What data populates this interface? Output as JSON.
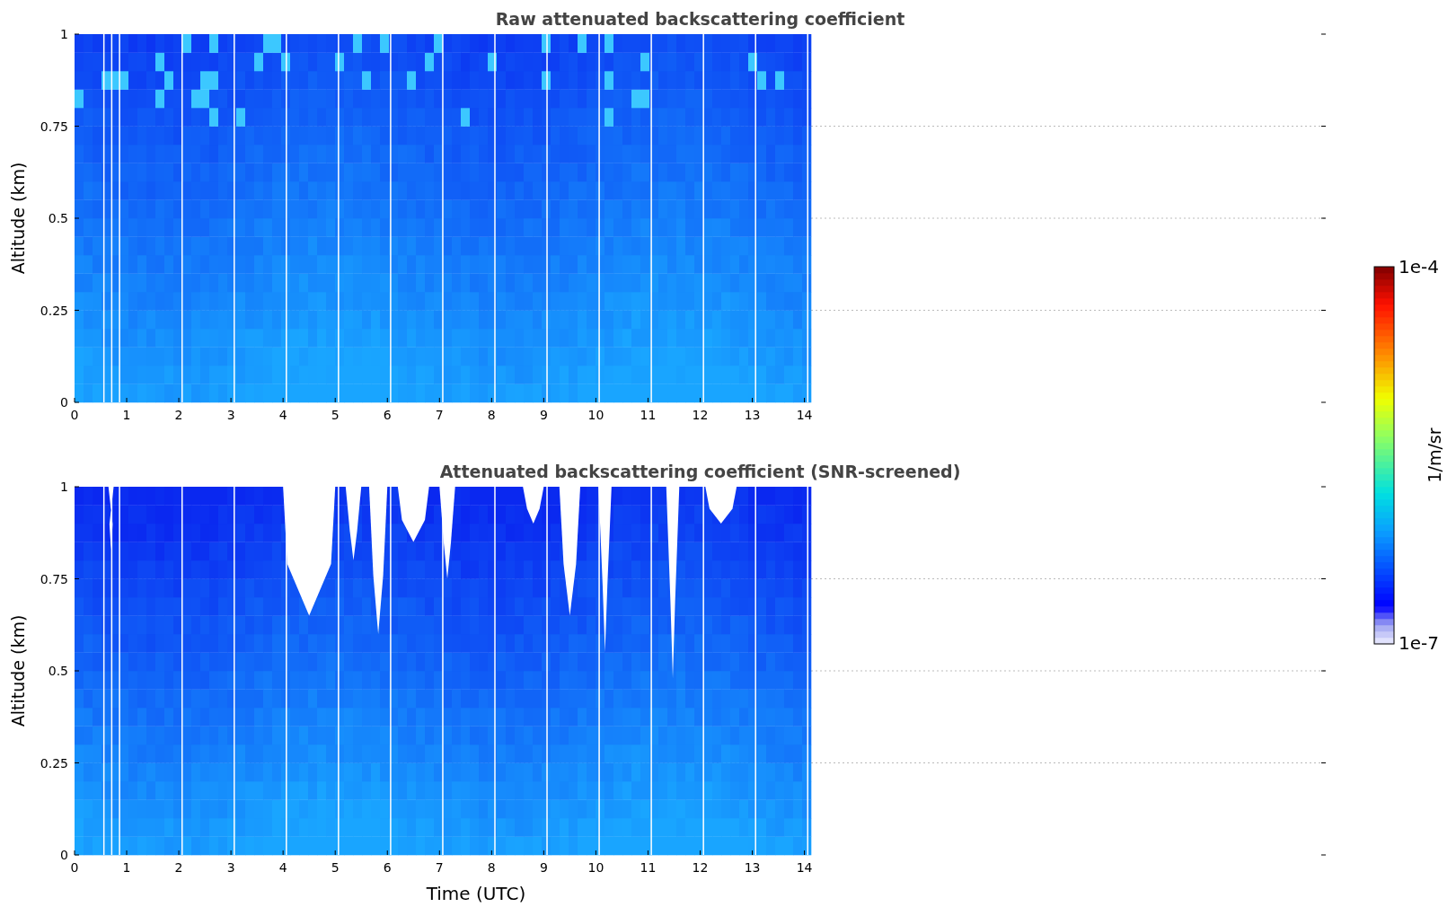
{
  "panels": [
    {
      "kind": "raw",
      "title": "Raw attenuated backscattering coefficient",
      "ylabel": "Altitude (km)",
      "yticks": [
        "1",
        "0.75",
        "0.5",
        "0.25",
        "0"
      ],
      "xticks": [
        "0",
        "1",
        "2",
        "3",
        "4",
        "5",
        "6",
        "7",
        "8",
        "9",
        "10",
        "11",
        "12",
        "13",
        "14"
      ]
    },
    {
      "kind": "screened",
      "title": "Attenuated backscattering coefficient (SNR-screened)",
      "ylabel": "Altitude (km)",
      "yticks": [
        "1",
        "0.75",
        "0.5",
        "0.25",
        "0"
      ],
      "xticks": [
        "0",
        "1",
        "2",
        "3",
        "4",
        "5",
        "6",
        "7",
        "8",
        "9",
        "10",
        "11",
        "12",
        "13",
        "14"
      ],
      "xlabel": "Time (UTC)"
    }
  ],
  "colorbar": {
    "label": "1/m/sr",
    "max_label": "1e-4",
    "min_label": "1e-7"
  }
}
